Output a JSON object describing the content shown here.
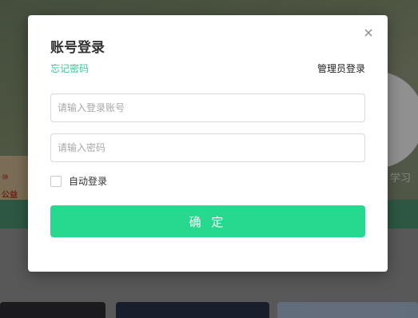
{
  "dialog": {
    "title": "账号登录",
    "forgot_password": "忘记密码",
    "admin_login": "管理员登录",
    "account_placeholder": "请输入登录账号",
    "password_placeholder": "请输入密码",
    "remember_label": "自动登录",
    "remember_checked": false,
    "confirm_label": "确 定",
    "close_icon": "close-icon"
  },
  "background": {
    "board_text_1": "⑩",
    "board_text_2": "公益",
    "side_text": "学习"
  },
  "colors": {
    "accent": "#26d98f",
    "link": "#2ecc8f",
    "overlay": "rgba(0,0,0,0.38)"
  }
}
